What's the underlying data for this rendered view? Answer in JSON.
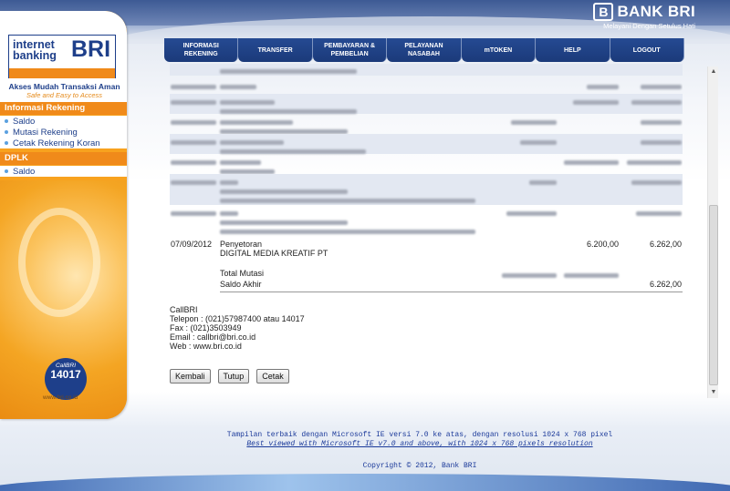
{
  "brand": {
    "name": "BANK BRI",
    "tagline": "Melayani Dengan Setulus Hati"
  },
  "sidebar": {
    "logo_line1": "internet",
    "logo_line2": "banking",
    "logo_bri": "BRI",
    "tagline1": "Akses Mudah Transaksi Aman",
    "tagline2": "Safe and Easy to Access",
    "section1": "Informasi Rekening",
    "section1_items": [
      "Saldo",
      "Mutasi Rekening",
      "Cetak Rekening Koran"
    ],
    "section2": "DPLK",
    "section2_items": [
      "Saldo"
    ],
    "callbri_label": "CallBRI",
    "callbri_number": "14017",
    "website": "www.bri.co.id"
  },
  "nav": {
    "items": [
      "INFORMASI\nREKENING",
      "TRANSFER",
      "PEMBAYARAN &\nPEMBELIAN",
      "PELAYANAN\nNASABAH",
      "mTOKEN",
      "HELP",
      "LOGOUT"
    ]
  },
  "statement": {
    "visible_row": {
      "date": "07/09/2012",
      "desc1": "Penyetoran",
      "desc2": "DIGITAL MEDIA KREATIF PT",
      "credit": "6.200,00",
      "balance": "6.262,00"
    },
    "total_mutasi_label": "Total Mutasi",
    "saldo_akhir_label": "Saldo Akhir",
    "saldo_akhir_value": "6.262,00"
  },
  "contact": {
    "title": "CallBRI",
    "telepon": "Telepon : (021)57987400 atau 14017",
    "fax": "Fax : (021)3503949",
    "email": "Email : callbri@bri.co.id",
    "web": "Web : www.bri.co.id"
  },
  "buttons": {
    "kembali": "Kembali",
    "tutup": "Tutup",
    "cetak": "Cetak"
  },
  "footer": {
    "line1": "Tampilan terbaik dengan Microsoft IE versi 7.0 ke atas, dengan resolusi 1024 x 768 pixel",
    "line2": "Best viewed with Microsoft IE v7.0 and above, with 1024 x 768 pixels resolution",
    "copyright": "Copyright © 2012, Bank BRI"
  },
  "colors": {
    "brand_blue": "#1e3f8a",
    "brand_orange": "#f08a1a",
    "row_shade": "#e3e8f2"
  }
}
